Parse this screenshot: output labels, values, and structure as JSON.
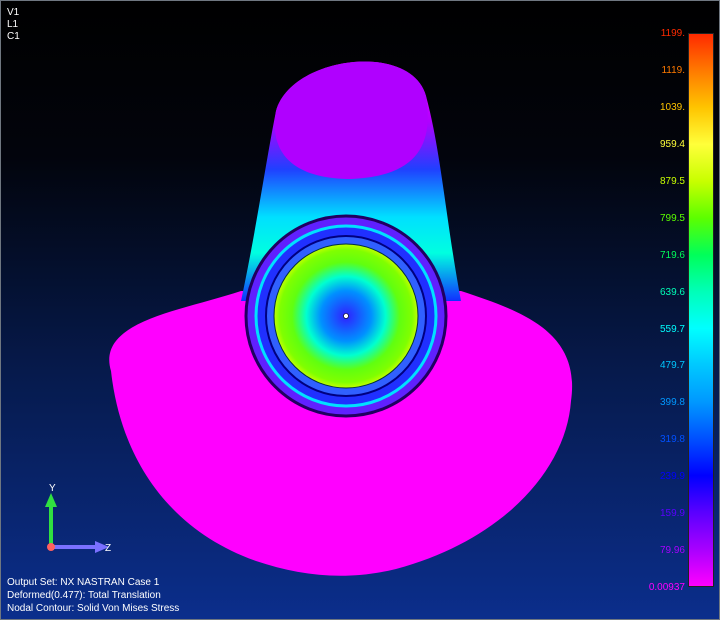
{
  "view_labels": [
    "V1",
    "L1",
    "C1"
  ],
  "legend": {
    "values": [
      "1199.",
      "1119.",
      "1039.",
      "959.4",
      "879.5",
      "799.5",
      "719.6",
      "639.6",
      "559.7",
      "479.7",
      "399.8",
      "319.8",
      "239.9",
      "159.9",
      "79.96",
      "0.00937"
    ],
    "colors": [
      "#ff2a00",
      "#ff7a00",
      "#ffc400",
      "#ffff3a",
      "#c8ff00",
      "#5cff00",
      "#00ff5a",
      "#00ffb8",
      "#00ffff",
      "#00c8ff",
      "#0098ff",
      "#0050ff",
      "#0000ff",
      "#5a00ff",
      "#a800ff",
      "#ff00ff"
    ]
  },
  "triad": {
    "y_label": "Y",
    "z_label": "Z"
  },
  "status": {
    "output_set": "Output Set: NX NASTRAN Case 1",
    "deformed": "Deformed(0.477): Total Translation",
    "contour": "Nodal Contour: Solid Von Mises Stress"
  }
}
